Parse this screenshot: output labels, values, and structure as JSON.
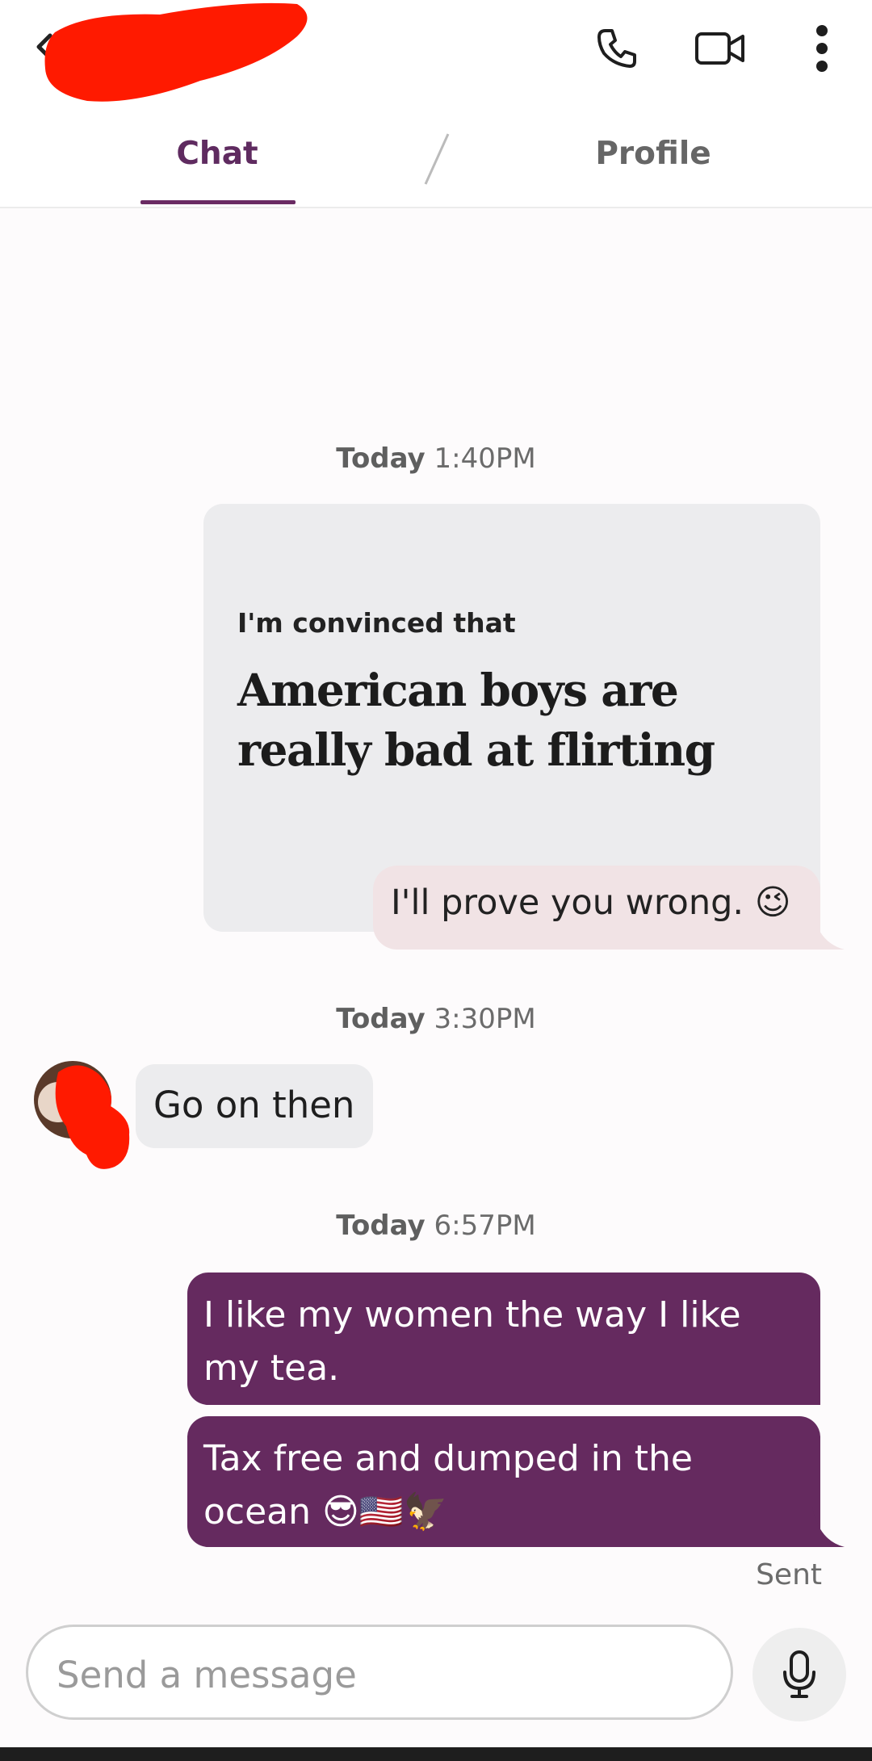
{
  "header": {
    "tabs": [
      {
        "label": "Chat",
        "active": true
      },
      {
        "label": "Profile",
        "active": false
      }
    ],
    "icons": [
      "back-icon",
      "phone-icon",
      "video-icon",
      "more-vert-icon"
    ]
  },
  "messages": {
    "ts1": {
      "day": "Today",
      "time": "1:40PM"
    },
    "prompt": {
      "label": "I'm convinced that",
      "title": "American boys are really bad at flirting",
      "reply": "I'll prove you wrong. 😉"
    },
    "ts2": {
      "day": "Today",
      "time": "3:30PM"
    },
    "received": "Go on then",
    "ts3": {
      "day": "Today",
      "time": "6:57PM"
    },
    "sent1": "I like my women the way I like my tea.",
    "sent2": "Tax free and dumped in the ocean 😎🇺🇸🦅",
    "status": "Sent"
  },
  "composer": {
    "placeholder": "Send a message"
  },
  "colors": {
    "accent": "#652a5f",
    "received_bubble": "#ececee",
    "reply_bubble": "#f1e3e5",
    "redaction": "#ff1a00"
  }
}
